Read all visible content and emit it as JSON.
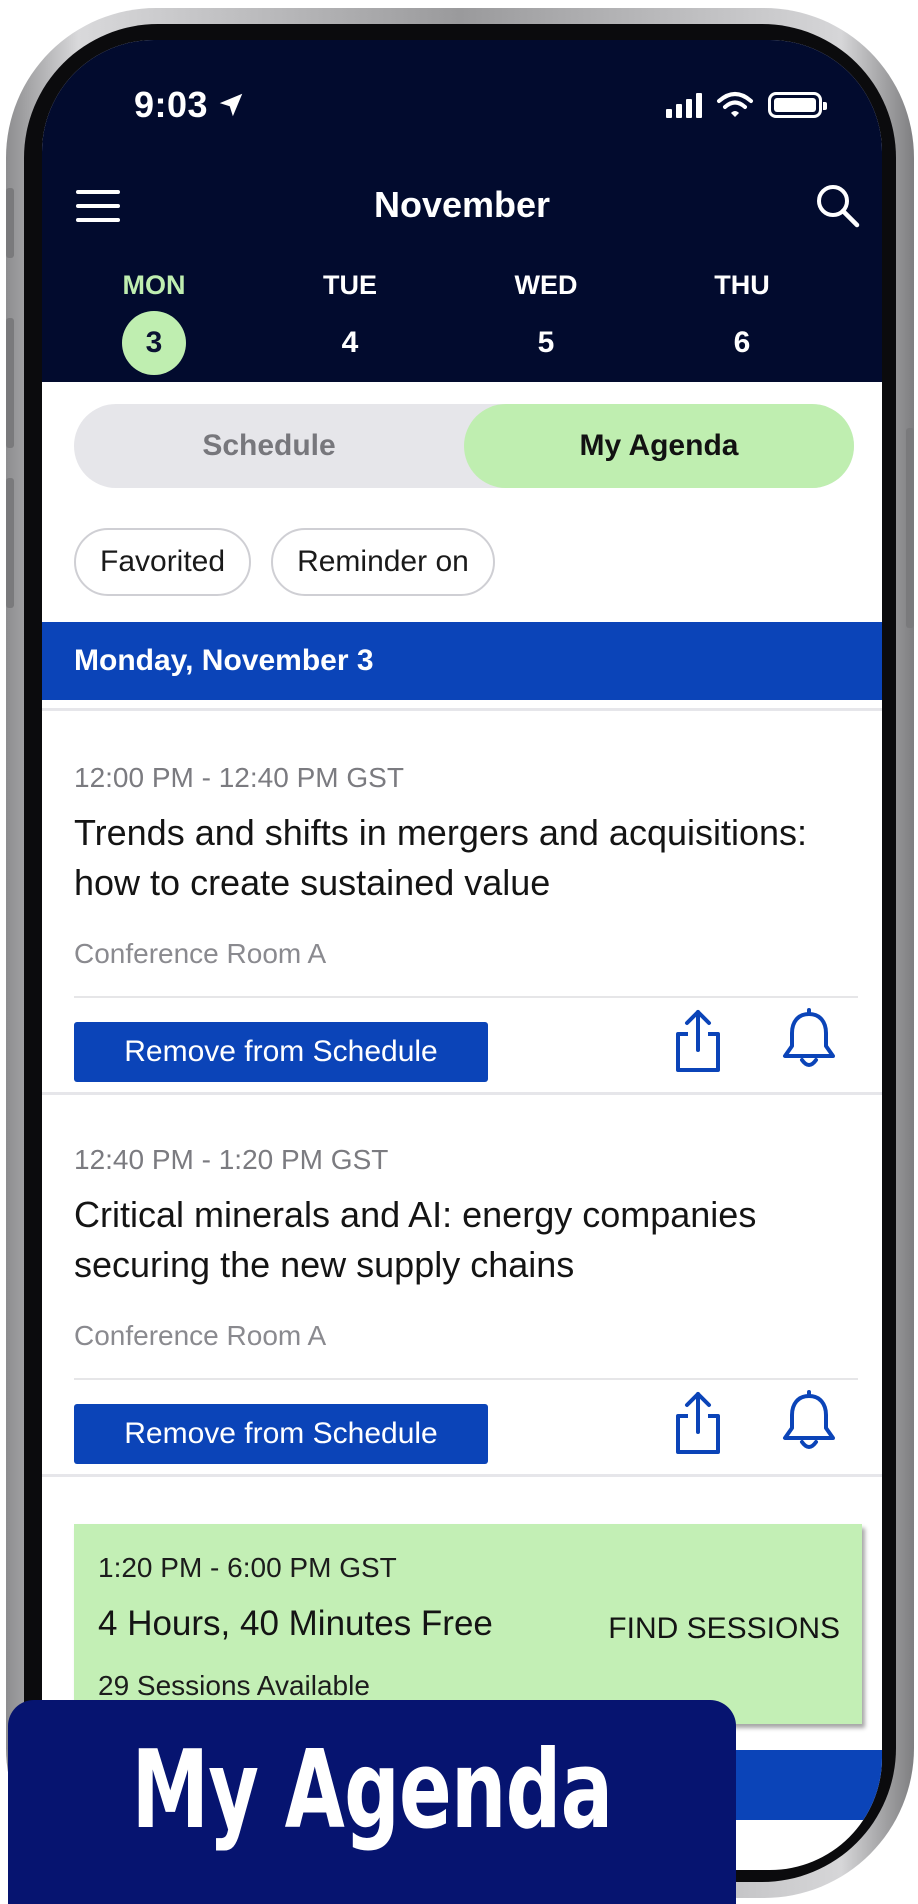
{
  "status_bar": {
    "time": "9:03"
  },
  "header": {
    "month": "November"
  },
  "days": [
    {
      "name": "MON",
      "num": "3",
      "active": true
    },
    {
      "name": "TUE",
      "num": "4",
      "active": false
    },
    {
      "name": "WED",
      "num": "5",
      "active": false
    },
    {
      "name": "THU",
      "num": "6",
      "active": false
    }
  ],
  "toggle": {
    "schedule_label": "Schedule",
    "agenda_label": "My Agenda",
    "selected": "My Agenda"
  },
  "filters": [
    "Favorited",
    "Reminder on"
  ],
  "date_header": "Monday, November 3",
  "sessions": [
    {
      "time": "12:00 PM - 12:40 PM GST",
      "title": "Trends and shifts in mergers and acquisitions: how to create sustained value",
      "room": "Conference Room A",
      "button": "Remove from Schedule"
    },
    {
      "time": "12:40 PM - 1:20 PM GST",
      "title": "Critical minerals and AI: energy companies securing the new supply chains",
      "room": "Conference Room A",
      "button": "Remove from Schedule"
    }
  ],
  "free_block": {
    "time": "1:20 PM - 6:00 PM GST",
    "title": "4 Hours, 40 Minutes Free",
    "count": "29 Sessions Available",
    "action": "FIND SESSIONS"
  },
  "banner": {
    "text": "My Agenda"
  },
  "colors": {
    "header_bg": "#020b2e",
    "accent_green": "#bfeeb0",
    "primary_blue": "#0b44b8",
    "banner_bg": "#061470"
  }
}
